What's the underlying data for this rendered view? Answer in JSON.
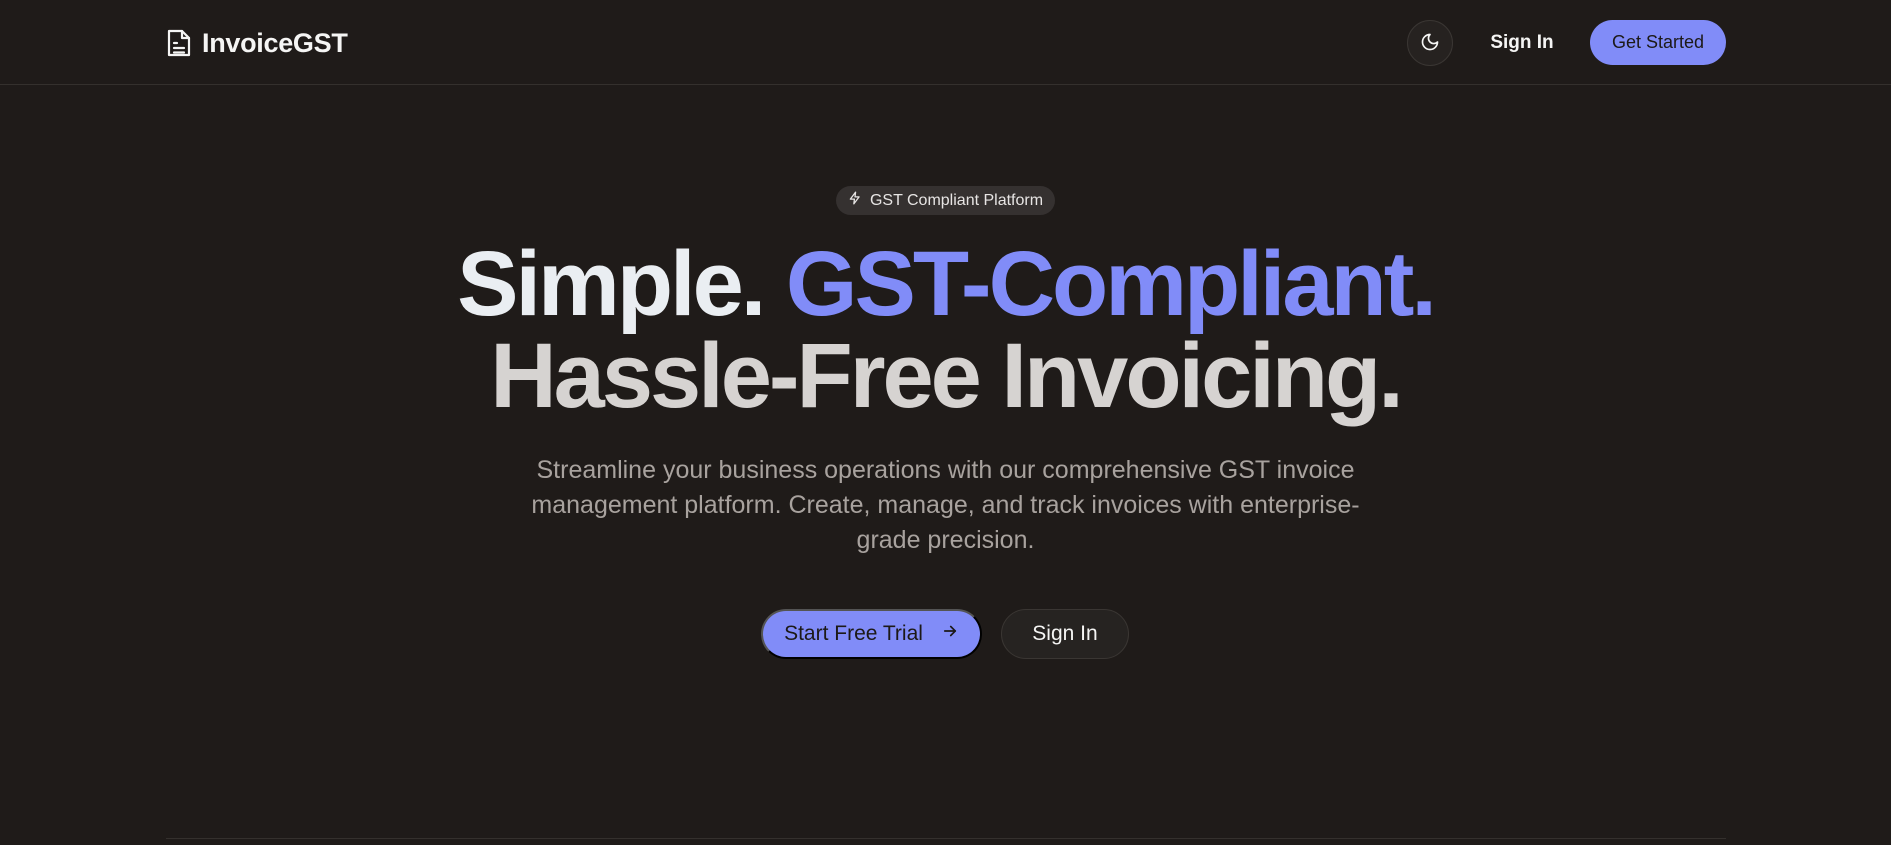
{
  "nav": {
    "brand_name": "InvoiceGST",
    "brand_icon": "document-icon",
    "theme_icon": "moon-icon",
    "sign_in_label": "Sign In",
    "get_started_label": "Get Started"
  },
  "hero": {
    "badge_icon": "lightning-icon",
    "badge_text": "GST Compliant Platform",
    "headline_part1": "Simple. ",
    "headline_part2": "GST-Compliant.",
    "headline_line2": "Hassle-Free Invoicing.",
    "subtitle": "Streamline your business operations with our comprehensive GST invoice management platform. Create, manage, and track invoices with enterprise-grade precision.",
    "primary_cta_label": "Start Free Trial",
    "primary_cta_icon": "arrow-right-icon",
    "secondary_cta_label": "Sign In"
  },
  "colors": {
    "background": "#1f1b19",
    "accent": "#818cf8",
    "text_primary": "#f5f5f4",
    "text_muted": "#a8a29e"
  }
}
